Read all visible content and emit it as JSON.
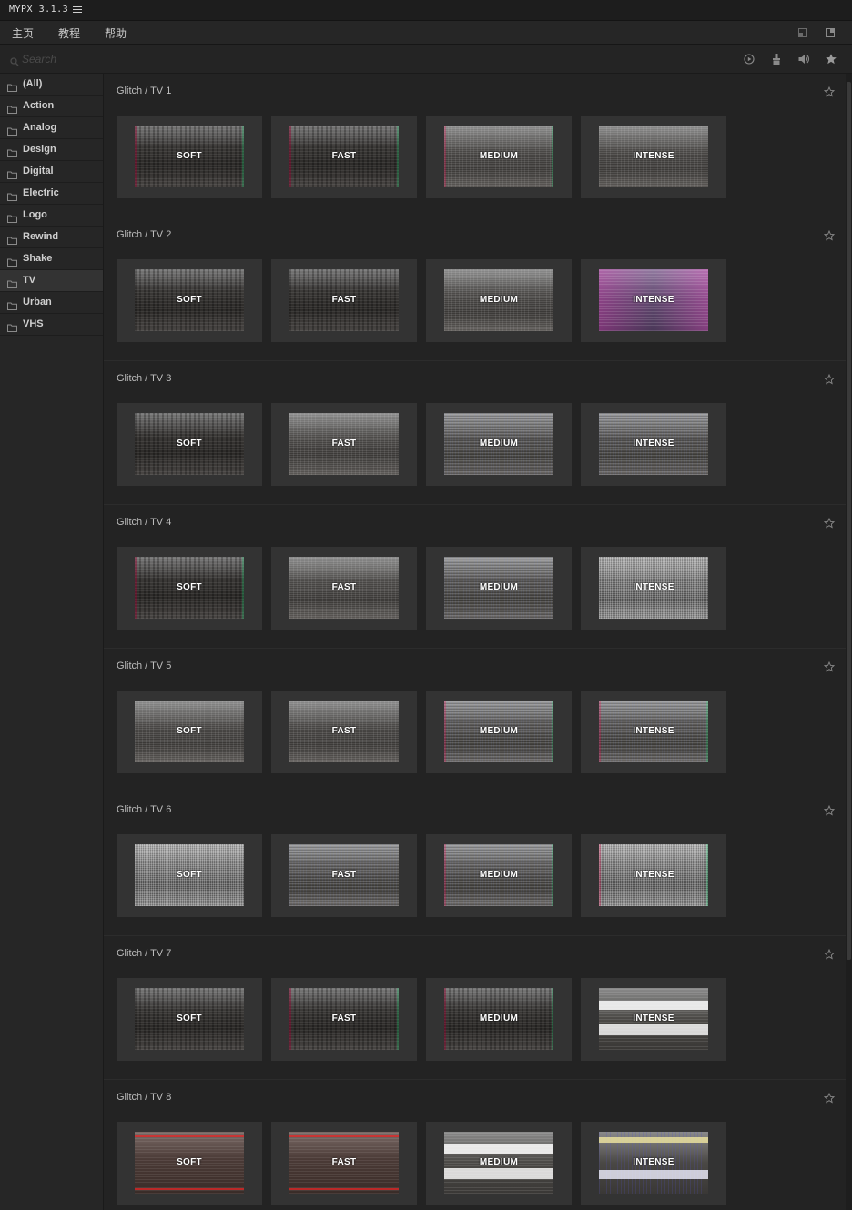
{
  "app": {
    "title": "MYPX 3.1.3"
  },
  "menu": {
    "items": [
      "主页",
      "教程",
      "帮助"
    ]
  },
  "search": {
    "placeholder": "Search"
  },
  "toolbar": {
    "icons": [
      "play-circle-icon",
      "brush-icon",
      "volume-icon",
      "star-filled-icon"
    ]
  },
  "categories": [
    {
      "label": "(All)"
    },
    {
      "label": "Action"
    },
    {
      "label": "Analog"
    },
    {
      "label": "Design"
    },
    {
      "label": "Digital"
    },
    {
      "label": "Electric"
    },
    {
      "label": "Logo"
    },
    {
      "label": "Rewind"
    },
    {
      "label": "Shake"
    },
    {
      "label": "TV",
      "selected": true
    },
    {
      "label": "Urban"
    },
    {
      "label": "VHS"
    }
  ],
  "presets": {
    "levels": [
      "SOFT",
      "FAST",
      "MEDIUM",
      "INTENSE"
    ],
    "sections": [
      {
        "title": "Glitch / TV 1"
      },
      {
        "title": "Glitch / TV 2"
      },
      {
        "title": "Glitch / TV 3"
      },
      {
        "title": "Glitch / TV 4"
      },
      {
        "title": "Glitch / TV 5"
      },
      {
        "title": "Glitch / TV 6"
      },
      {
        "title": "Glitch / TV 7"
      },
      {
        "title": "Glitch / TV 8"
      }
    ]
  },
  "colors": {
    "background": "#232323",
    "panel": "#262626",
    "card": "#333333",
    "selected": "#333333",
    "text": "#c8c8c8"
  }
}
